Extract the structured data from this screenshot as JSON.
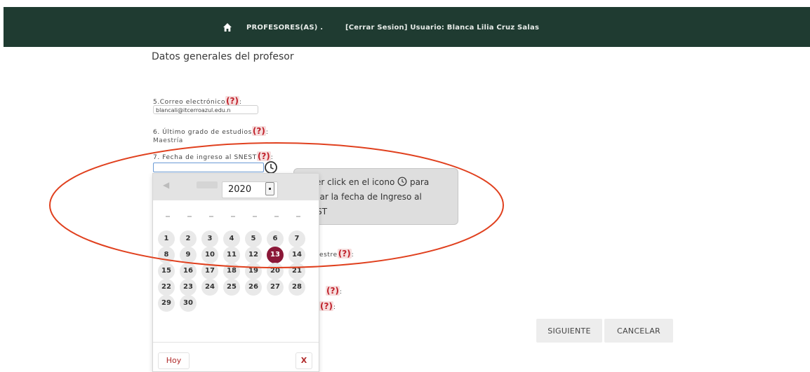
{
  "navbar": {
    "home_icon": "home-icon",
    "profesores_link": "PROFESORES(AS) .",
    "session_link": "[Cerrar Sesion] Usuario: Blanca Lilia Cruz Salas"
  },
  "page_title": "Datos generales del profesor",
  "form": {
    "email": {
      "label": "5.Correo electrónico",
      "help": "(?)",
      "colon": ":",
      "value": "blancali@itcerroazul.edu.n"
    },
    "degree": {
      "label": "6. Último grado de estudios",
      "help": "(?)",
      "colon": ":",
      "value": "Maestría"
    },
    "ingreso": {
      "label": "7. Fecha de ingreso al SNEST",
      "help": "(?)",
      "colon": ":",
      "value": ""
    },
    "hidden_fields": [
      {
        "label_tail": "estre",
        "help": "(?)",
        "colon": ":"
      },
      {
        "label_tail": "",
        "help": "(?)",
        "colon": ":"
      },
      {
        "label_tail": "",
        "help": "(?)",
        "colon": ":"
      }
    ]
  },
  "tooltip": {
    "text_before": "Hacer click en el icono",
    "text_after": "para indicar la fecha de Ingreso al SNEST",
    "icon": "clock-icon"
  },
  "datepicker": {
    "year": "2020",
    "selected_day": "13",
    "days": [
      "1",
      "2",
      "3",
      "4",
      "5",
      "6",
      "7",
      "8",
      "9",
      "10",
      "11",
      "12",
      "13",
      "14",
      "15",
      "16",
      "17",
      "18",
      "19",
      "20",
      "21",
      "22",
      "23",
      "24",
      "25",
      "26",
      "27",
      "28",
      "29",
      "30"
    ],
    "today_button": "Hoy",
    "clear_button": "X"
  },
  "buttons": {
    "next": "SIGUIENTE",
    "cancel": "CANCELAR"
  },
  "colors": {
    "navbar": "#1f3b31",
    "selected_day": "#8b1838",
    "help_mark": "#c0202a",
    "annotation": "#e0401e"
  }
}
